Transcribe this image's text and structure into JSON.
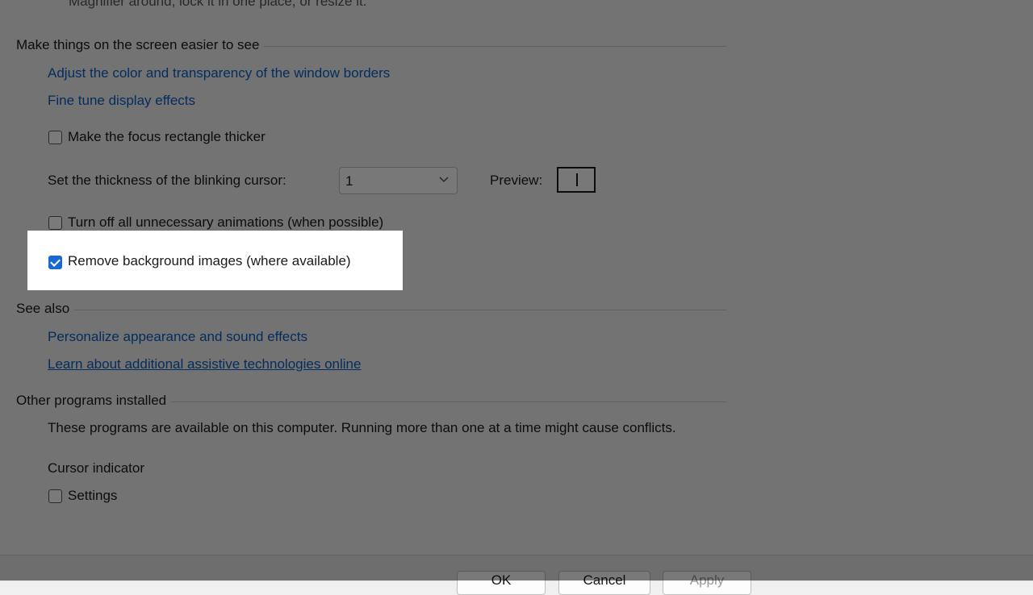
{
  "truncated_top_text": "Magnifier around, lock it in one place, or resize it.",
  "section_make_easier": {
    "title": "Make things on the screen easier to see",
    "link_window_borders": "Adjust the color and transparency of the window borders",
    "link_display_effects": "Fine tune display effects",
    "focus_rectangle_label": "Make the focus rectangle thicker",
    "focus_rectangle_checked": false,
    "cursor_thickness_label": "Set the thickness of the blinking cursor:",
    "cursor_thickness_value": "1",
    "preview_label": "Preview:",
    "animations_label": "Turn off all unnecessary animations (when possible)",
    "animations_checked": false,
    "remove_bg_label": "Remove background images (where available)",
    "remove_bg_checked": true
  },
  "section_see_also": {
    "title": "See also",
    "link_personalize": "Personalize appearance and sound effects",
    "link_learn_more": "Learn about additional assistive technologies online"
  },
  "section_other_programs": {
    "title": "Other programs installed",
    "description": "These programs are available on this computer. Running more than one at a time might cause conflicts.",
    "program_name": "Cursor indicator",
    "settings_label": "Settings",
    "settings_checked": false
  },
  "footer": {
    "ok_label": "OK",
    "cancel_label": "Cancel",
    "apply_label": "Apply"
  },
  "colors": {
    "link": "#0a5fc4",
    "checkbox_checked": "#1769d1",
    "overlay": "rgba(0,0,0,0.52)"
  },
  "icons": {
    "dropdown": "chevron-down-icon",
    "checkmark": "checkmark-icon"
  }
}
